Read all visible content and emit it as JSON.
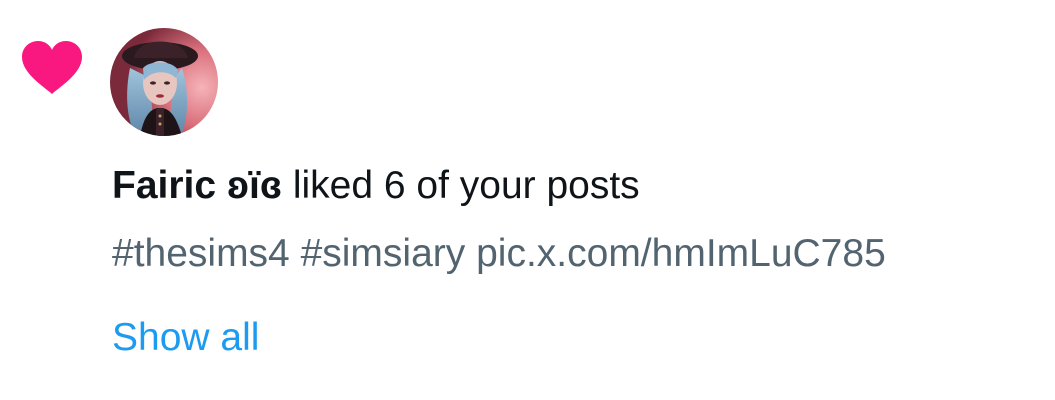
{
  "notification": {
    "type_icon": "heart-icon",
    "icon_color": "#f91880",
    "user_name": "Fairic ʚïɞ",
    "action_text": " liked 6 of your posts",
    "post_text": "#thesims4 #simsiary pic.x.com/hmImLuC785",
    "show_all_label": "Show all"
  },
  "colors": {
    "primary_text": "#0f1419",
    "secondary_text": "#536471",
    "link": "#1d9bf0"
  }
}
